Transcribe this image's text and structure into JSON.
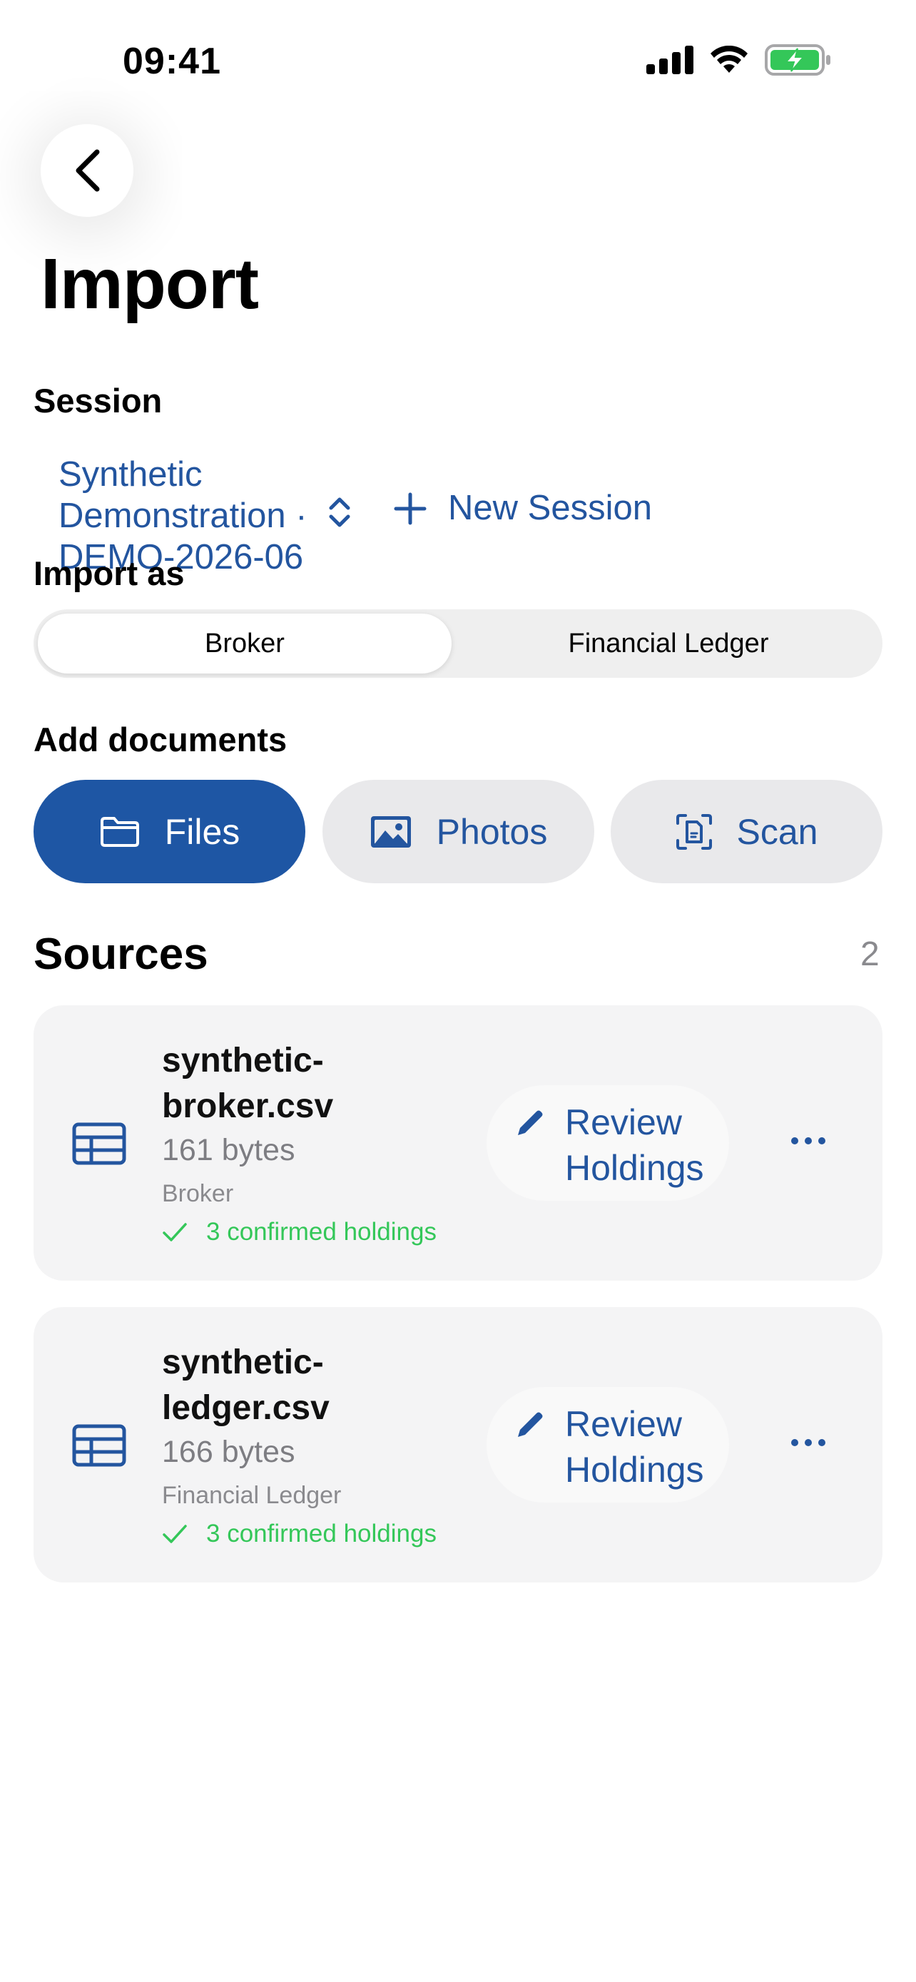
{
  "status_bar": {
    "time": "09:41"
  },
  "header": {
    "title": "Import"
  },
  "session": {
    "label": "Session",
    "current": "Synthetic Demonstration · DEMO-2026-06",
    "new_label": "New Session"
  },
  "import_as": {
    "label": "Import as",
    "options": [
      "Broker",
      "Financial Ledger"
    ],
    "selected": "Broker"
  },
  "add_documents": {
    "label": "Add documents",
    "buttons": [
      {
        "label": "Files",
        "icon": "folder-icon"
      },
      {
        "label": "Photos",
        "icon": "photo-icon"
      },
      {
        "label": "Scan",
        "icon": "document-scan-icon"
      }
    ]
  },
  "sources": {
    "title": "Sources",
    "count": "2",
    "items": [
      {
        "name": "synthetic-broker.csv",
        "size": "161 bytes",
        "type": "Broker",
        "status": "3 confirmed holdings",
        "action": "Review Holdings"
      },
      {
        "name": "synthetic-ledger.csv",
        "size": "166 bytes",
        "type": "Financial Ledger",
        "status": "3 confirmed holdings",
        "action": "Review Holdings"
      }
    ]
  },
  "colors": {
    "accent": "#1e56a4",
    "link": "#23559f",
    "success": "#34c759",
    "card_bg": "#f4f4f5",
    "secondary_button_bg": "#e9e9eb"
  }
}
